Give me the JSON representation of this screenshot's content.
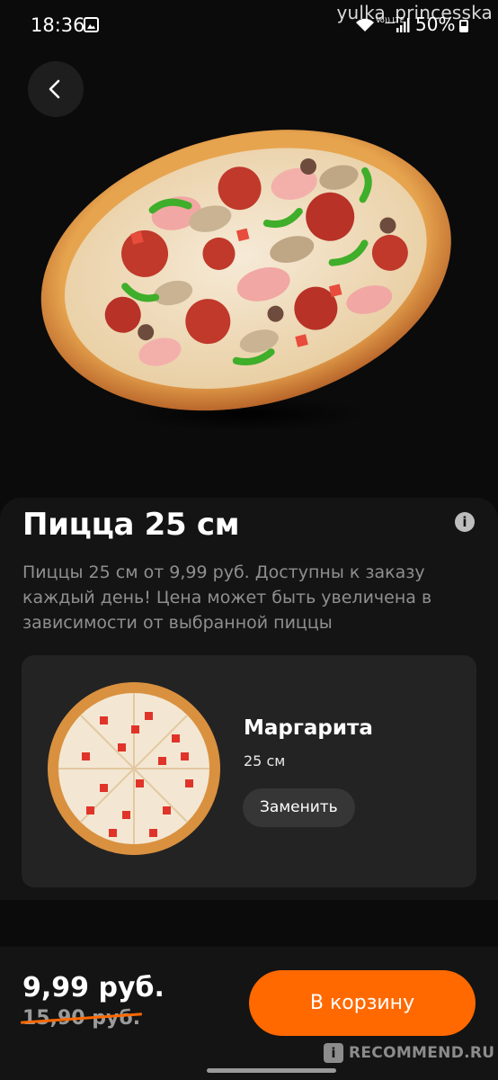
{
  "status_bar": {
    "time": "18:36",
    "watermark": "yulka_princesska",
    "network_label": "Vo)) LTE",
    "battery": "50%"
  },
  "product": {
    "title": "Пицца 25 см",
    "description": "Пиццы 25 см от 9,99 руб. Доступны к заказу каждый день! Цена может быть увеличена в зависимости от выбранной пиццы",
    "info_icon": "info-icon"
  },
  "selected_pizza": {
    "name": "Маргарита",
    "size": "25 см",
    "replace_label": "Заменить"
  },
  "footer": {
    "price": "9,99 руб.",
    "old_price": "15,90 руб.",
    "cart_label": "В корзину",
    "watermark": "RECOMMEND.RU",
    "watermark_logo": "i"
  },
  "colors": {
    "accent": "#ff6900",
    "background": "#0b0b0b",
    "sheet": "#141414",
    "card": "#232323"
  }
}
